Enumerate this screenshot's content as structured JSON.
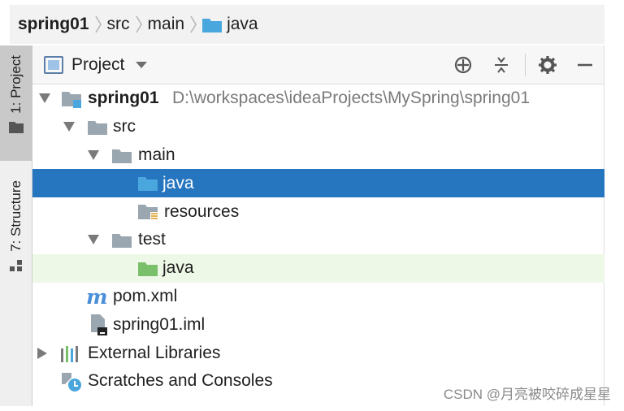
{
  "breadcrumb": {
    "items": [
      "spring01",
      "src",
      "main",
      "java"
    ]
  },
  "sidebar": {
    "tabs": [
      {
        "label": "1: Project",
        "active": true
      },
      {
        "label": "7: Structure",
        "active": false
      }
    ]
  },
  "panel": {
    "title": "Project",
    "tools": [
      "crosshair-icon",
      "collapse-all-icon",
      "gear-icon",
      "minimize-icon"
    ]
  },
  "tree": {
    "rows": [
      {
        "label": "spring01",
        "path": "D:\\workspaces\\ideaProjects\\MySpring\\spring01"
      },
      {
        "label": "src"
      },
      {
        "label": "main"
      },
      {
        "label": "java"
      },
      {
        "label": "resources"
      },
      {
        "label": "test"
      },
      {
        "label": "java"
      },
      {
        "label": "pom.xml"
      },
      {
        "label": "spring01.iml"
      },
      {
        "label": "External Libraries"
      },
      {
        "label": "Scratches and Consoles"
      }
    ]
  },
  "watermark": "CSDN @月亮被咬碎成星星",
  "colors": {
    "selection": "#2675bf",
    "hover_row": "#eef8e6",
    "folder_blue": "#49a7de",
    "folder_green": "#7ac06a",
    "folder_gray": "#9aa7b0"
  }
}
